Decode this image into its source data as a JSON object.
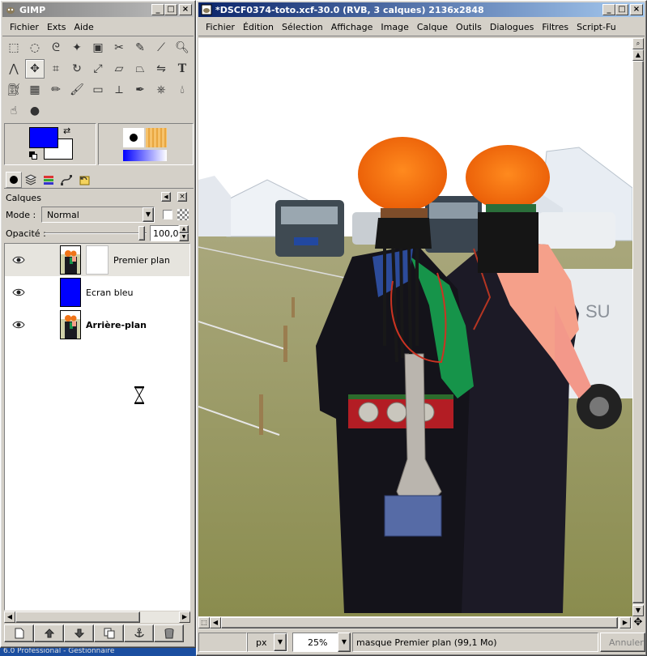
{
  "toolbox": {
    "title": "GIMP",
    "menu": [
      "Fichier",
      "Exts",
      "Aide"
    ],
    "tools": [
      "rect-select-icon",
      "ellipse-select-icon",
      "lasso-icon",
      "magic-wand-icon",
      "color-select-icon",
      "scissors-icon",
      "paths-icon",
      "color-picker-icon",
      "zoom-icon",
      "measure-icon",
      "move-icon",
      "crop-icon",
      "rotate-icon",
      "scale-icon",
      "shear-icon",
      "perspective-icon",
      "flip-icon",
      "text-icon",
      "bucket-fill-icon",
      "blend-icon",
      "pencil-icon",
      "paintbrush-icon",
      "eraser-icon",
      "airbrush-icon",
      "ink-icon",
      "clone-icon",
      "blur-icon",
      "smudge-icon",
      "dodge-icon"
    ],
    "fg_color": "#0000ff",
    "bg_color": "#ffffff"
  },
  "layers_dock": {
    "title": "Calques",
    "mode_label": "Mode :",
    "mode_value": "Normal",
    "opacity_label": "Opacité :",
    "opacity_value": "100,0",
    "opacity_percent": 100,
    "layers": [
      {
        "name": "Premier plan",
        "bold": false,
        "selected": true,
        "thumb": "photo",
        "mask": true
      },
      {
        "name": "Ecran bleu",
        "bold": false,
        "selected": false,
        "thumb": "blue",
        "mask": false
      },
      {
        "name": "Arrière-plan",
        "bold": true,
        "selected": false,
        "thumb": "photo",
        "mask": false
      }
    ]
  },
  "image_window": {
    "title": "*DSCF0374-toto.xcf-30.0 (RVB, 3 calques) 2136x2848",
    "menu": [
      "Fichier",
      "Édition",
      "Sélection",
      "Affichage",
      "Image",
      "Calque",
      "Outils",
      "Dialogues",
      "Filtres",
      "Script-Fu"
    ],
    "unit": "px",
    "zoom": "25%",
    "status": "masque Premier plan (99,1 Mo)",
    "cancel_label": "Annuler"
  },
  "taskbar": {
    "label": "6.0 Professional - Gestionnaire"
  }
}
